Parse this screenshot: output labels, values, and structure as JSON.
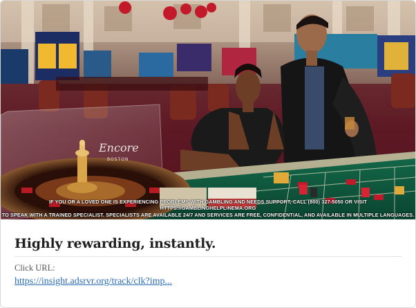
{
  "ad": {
    "image": {
      "alt_semantics": "casino roulette table with couple",
      "disclaimer_line1": "IF YOU OR A LOVED ONE IS EXPERIENCING PROBLEMS WITH GAMBLING AND NEEDS SUPPORT, CALL (800) 327-5050 OR VISIT HTTPS://GAMBLINGHELPLINEMA.ORG",
      "disclaimer_line2": "TO SPEAK WITH A TRAINED SPECIALIST. SPECIALISTS ARE AVAILABLE 24/7 AND SERVICES ARE FREE, CONFIDENTIAL, AND AVAILABLE IN MULTIPLE LANGUAGES.",
      "logo_text": "Encore",
      "logo_subtext": "BOSTON"
    },
    "headline": "Highly rewarding, instantly.",
    "click_url_label": "Click URL:",
    "click_url": "https://insight.adsrvr.org/track/clk?imp..."
  },
  "colors": {
    "felt": "#0e5b3f",
    "wood": "#6a3a1c",
    "carpet": "#6e1b25",
    "link": "#2a6db3"
  }
}
